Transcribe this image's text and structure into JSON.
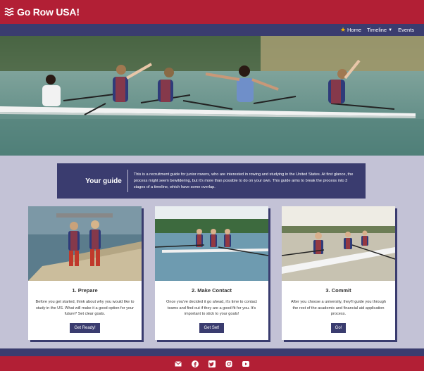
{
  "header": {
    "brand": "Go Row USA!"
  },
  "nav": {
    "home": "Home",
    "timeline": "Timeline",
    "events": "Events"
  },
  "intro": {
    "title": "Your guide",
    "text": "This is a recruitment guide for junior rowers, who are interested in rowing and studying in the United States. At first glance, the process might seem bewildering, but it's more than possible to do on your own. This guide aims to break the process into 3 stages of a timeline, which have some overlap."
  },
  "cards": [
    {
      "title": "1. Prepare",
      "text": "Before you get started, think about why you would like to study in the US. What will make it a good option for your future? Set clear goals.",
      "button": "Get Ready!"
    },
    {
      "title": "2. Make Contact",
      "text": "Once you've decided it go ahead, it's time to contact teams and find out if they are a good fit for you. It's important to stick to your goals!",
      "button": "Get Set!"
    },
    {
      "title": "3. Commit",
      "text": "After you choose a university, they'll guide you through the rest of the academic and financial aid application process.",
      "button": "Go!"
    }
  ],
  "footer": {
    "icons": [
      "envelope-icon",
      "facebook-icon",
      "twitter-icon",
      "instagram-icon",
      "youtube-icon"
    ]
  },
  "colors": {
    "red": "#b21f35",
    "navy": "#3a3c6f",
    "background": "#c3c2d6"
  }
}
